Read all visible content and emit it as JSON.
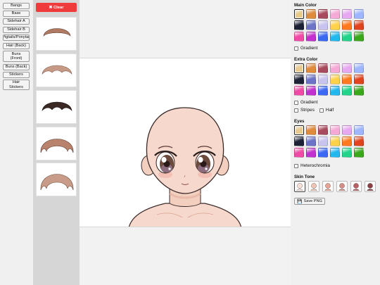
{
  "categories": [
    {
      "label": "Bangs"
    },
    {
      "label": "Base"
    },
    {
      "label": "Sidehair A"
    },
    {
      "label": "Sidehair B"
    },
    {
      "label": "Pigtails/Ponytail"
    },
    {
      "label": "Hair (Back)"
    },
    {
      "label": "Buns\n(Front)"
    },
    {
      "label": "Buns (Back)"
    },
    {
      "label": "Stickers"
    },
    {
      "label": "Hair\nStickers"
    }
  ],
  "thumbnails": {
    "clear_label": "✖ Clear",
    "items": [
      "bangs-style-1",
      "bangs-style-2",
      "bangs-style-3",
      "bangs-style-4",
      "bangs-style-5"
    ]
  },
  "main_color": {
    "title": "Main Color",
    "gradient_label": "Gradient",
    "swatches": [
      "#e8c98e",
      "#e08a3c",
      "#a84a5e",
      "#f5a9d6",
      "#e7a8f2",
      "#9db6ff",
      "#1d2136",
      "#6c73c8",
      "#c9c3f0",
      "#ffd24a",
      "#ff7a1e",
      "#e2421e",
      "#f04aa6",
      "#c430cf",
      "#3c69f2",
      "#21b8f0",
      "#21d48a",
      "#3aa81a"
    ]
  },
  "extra_color": {
    "title": "Extra Color",
    "gradient_label": "Gradient",
    "stripes_label": "Stripes",
    "half_label": "Half",
    "swatches": [
      "#e8c98e",
      "#e08a3c",
      "#a84a5e",
      "#f5a9d6",
      "#e7a8f2",
      "#9db6ff",
      "#1d2136",
      "#6c73c8",
      "#c9c3f0",
      "#ffd24a",
      "#ff7a1e",
      "#e2421e",
      "#f04aa6",
      "#c430cf",
      "#3c69f2",
      "#21b8f0",
      "#21d48a",
      "#3aa81a"
    ]
  },
  "eyes": {
    "title": "Eyes",
    "heterochromia_label": "Heterochromia",
    "swatches": [
      "#e8c98e",
      "#e08a3c",
      "#a84a5e",
      "#f5a9d6",
      "#e7a8f2",
      "#9db6ff",
      "#1d2136",
      "#6c73c8",
      "#c9c3f0",
      "#ffd24a",
      "#ff7a1e",
      "#e2421e",
      "#f04aa6",
      "#c430cf",
      "#3c69f2",
      "#21b8f0",
      "#21d48a",
      "#3aa81a"
    ]
  },
  "skin_tone": {
    "title": "Skin Tone",
    "tones": [
      "#f7e1d7",
      "#f1c4b4",
      "#e6a394",
      "#d88c86",
      "#b75f62",
      "#8e3f44"
    ]
  },
  "save_label": "Save PNG",
  "colors": {
    "clear_button": "#ef3b3b",
    "skin": "#f6d9cc",
    "skin_shade": "#e9b9a7"
  }
}
